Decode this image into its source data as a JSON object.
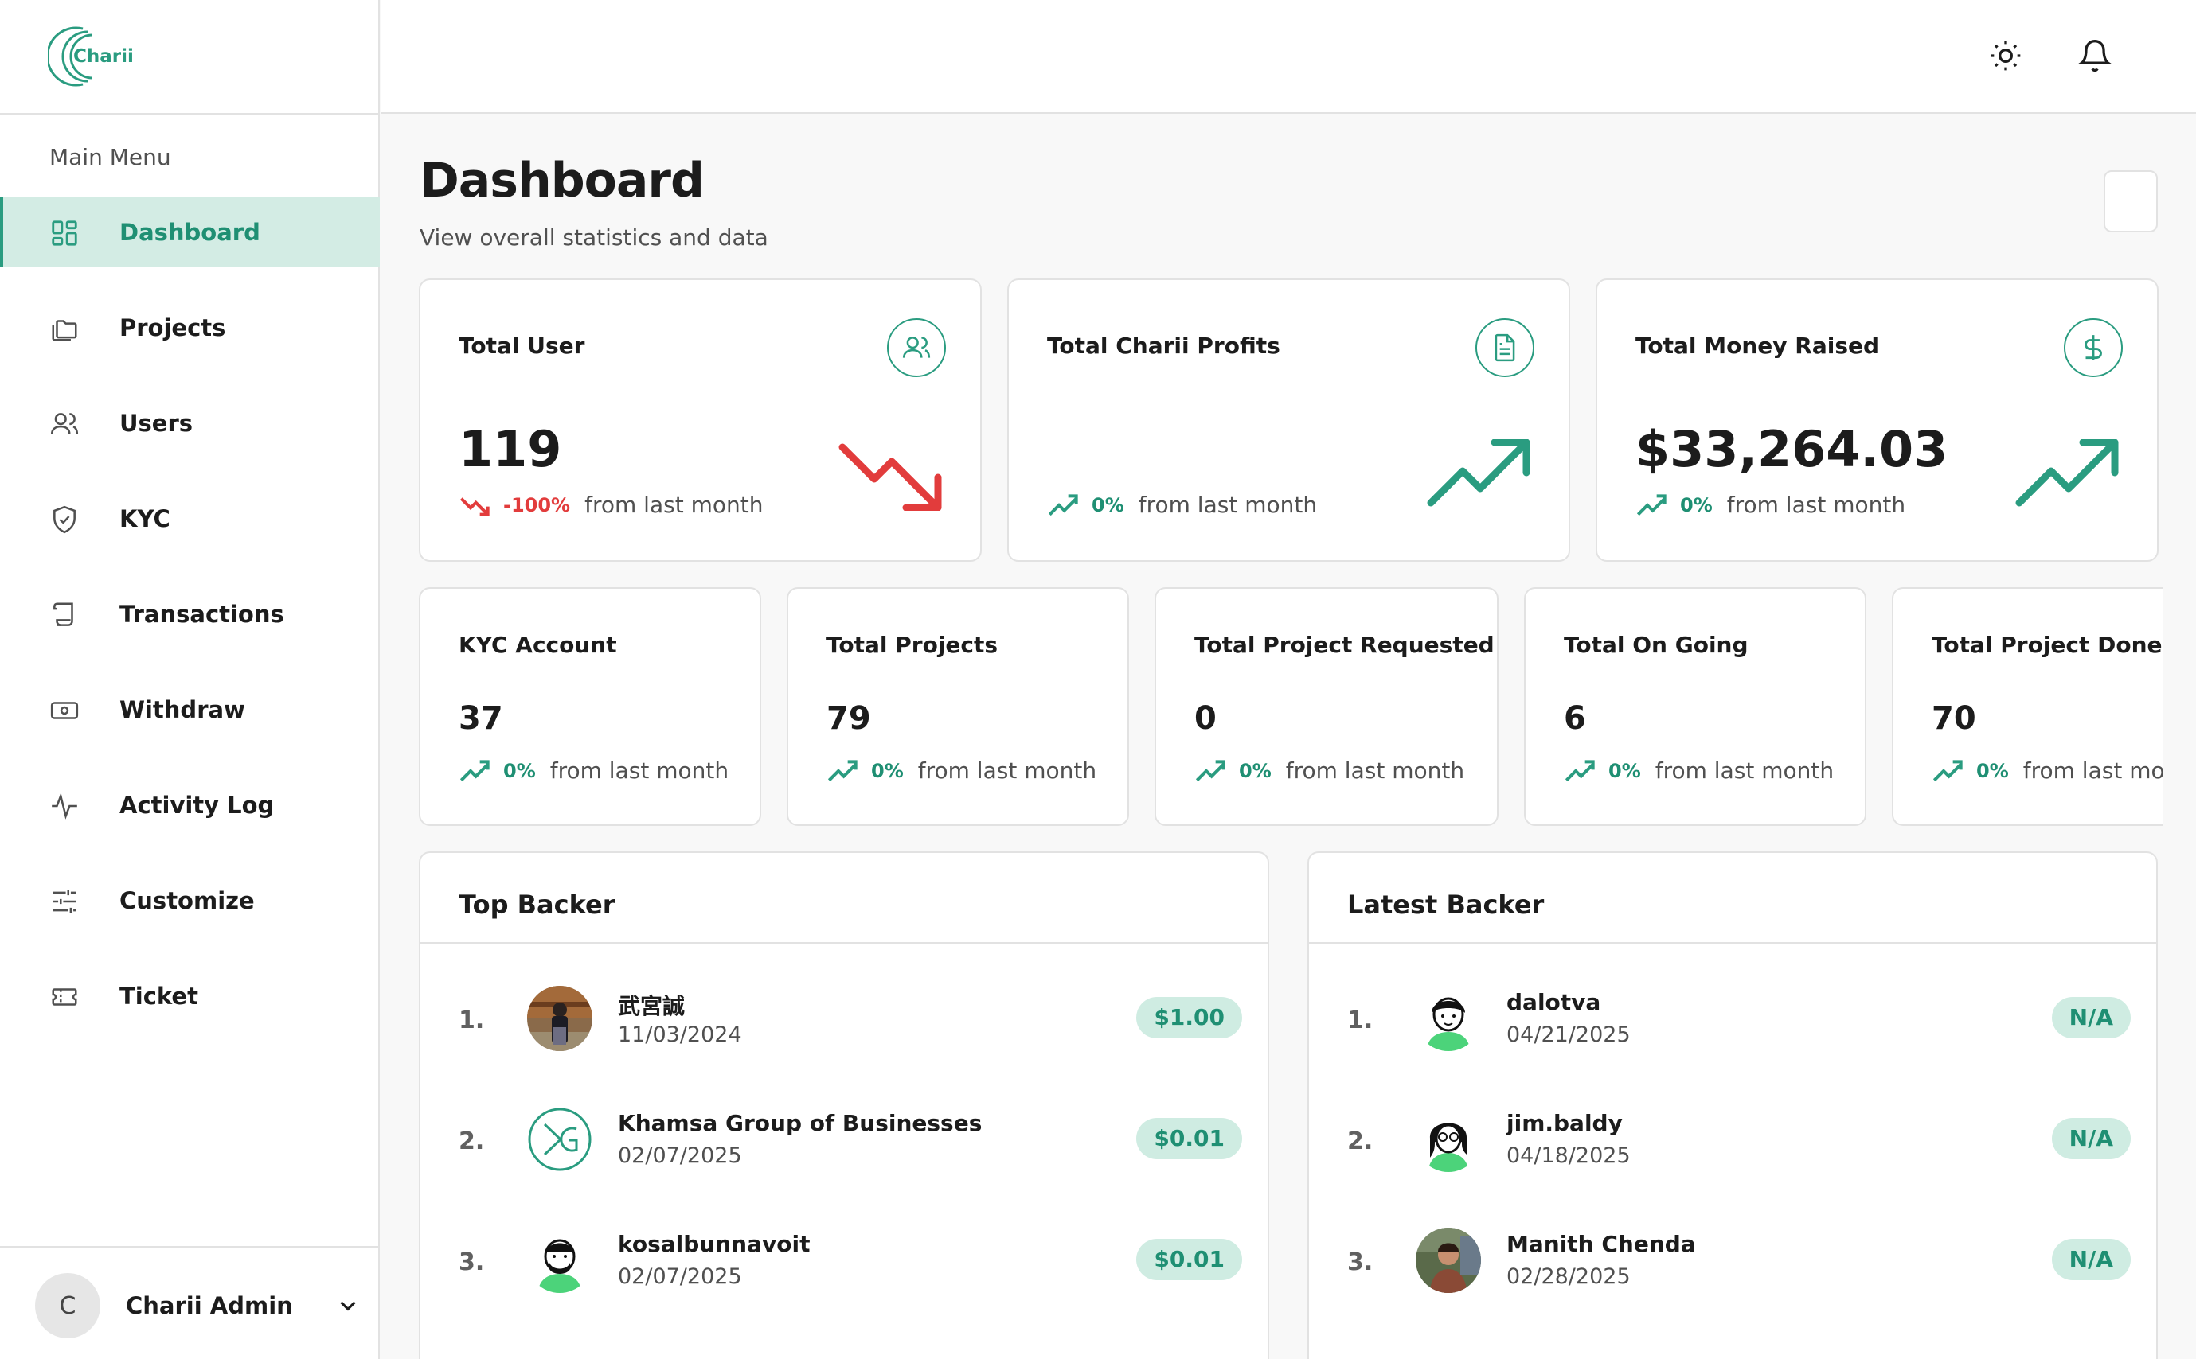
{
  "brand": {
    "name": "Charii",
    "color": "#2a9c80"
  },
  "sidebar": {
    "menu_title": "Main Menu",
    "items": [
      {
        "label": "Dashboard",
        "icon": "grid-icon",
        "active": true
      },
      {
        "label": "Projects",
        "icon": "folders-icon"
      },
      {
        "label": "Users",
        "icon": "users-icon"
      },
      {
        "label": "KYC",
        "icon": "shield-check-icon"
      },
      {
        "label": "Transactions",
        "icon": "scroll-icon"
      },
      {
        "label": "Withdraw",
        "icon": "banknote-icon"
      },
      {
        "label": "Activity Log",
        "icon": "activity-icon"
      },
      {
        "label": "Customize",
        "icon": "sliders-icon"
      },
      {
        "label": "Ticket",
        "icon": "ticket-icon"
      }
    ],
    "user": {
      "initial": "C",
      "name": "Charii Admin"
    }
  },
  "topbar": {
    "icons": [
      "sun-icon",
      "bell-icon"
    ]
  },
  "page": {
    "title": "Dashboard",
    "subtitle": "View overall statistics and data"
  },
  "stats_top": [
    {
      "title": "Total User",
      "value": "119",
      "pct": "-100%",
      "from": "from last month",
      "direction": "down",
      "icon": "users-icon"
    },
    {
      "title": "Total Charii Profits",
      "value": "",
      "pct": "0%",
      "from": "from last month",
      "direction": "up",
      "icon": "file-text-icon"
    },
    {
      "title": "Total Money Raised",
      "value": "$33,264.03",
      "pct": "0%",
      "from": "from last month",
      "direction": "up",
      "icon": "dollar-icon"
    }
  ],
  "stats_small": [
    {
      "title": "KYC Account",
      "value": "37",
      "pct": "0%",
      "from": "from last month"
    },
    {
      "title": "Total Projects",
      "value": "79",
      "pct": "0%",
      "from": "from last month"
    },
    {
      "title": "Total Project Requested",
      "value": "0",
      "pct": "0%",
      "from": "from last month"
    },
    {
      "title": "Total On Going",
      "value": "6",
      "pct": "0%",
      "from": "from last month"
    },
    {
      "title": "Total Project Done",
      "value": "70",
      "pct": "0%",
      "from": "from last mo"
    }
  ],
  "top_backer": {
    "title": "Top Backer",
    "rows": [
      {
        "rank": "1.",
        "name": "武宮誠",
        "date": "11/03/2024",
        "amount": "$1.00"
      },
      {
        "rank": "2.",
        "name": "Khamsa Group of Businesses",
        "date": "02/07/2025",
        "amount": "$0.01"
      },
      {
        "rank": "3.",
        "name": "kosalbunnavoit",
        "date": "02/07/2025",
        "amount": "$0.01"
      }
    ]
  },
  "latest_backer": {
    "title": "Latest Backer",
    "rows": [
      {
        "rank": "1.",
        "name": "dalotva",
        "date": "04/21/2025",
        "amount": "N/A"
      },
      {
        "rank": "2.",
        "name": "jim.baldy",
        "date": "04/18/2025",
        "amount": "N/A"
      },
      {
        "rank": "3.",
        "name": "Manith Chenda",
        "date": "02/28/2025",
        "amount": "N/A"
      }
    ]
  },
  "colors": {
    "accent": "#2a9c80",
    "down": "#e23c3c",
    "badge_bg": "#cfece2"
  }
}
